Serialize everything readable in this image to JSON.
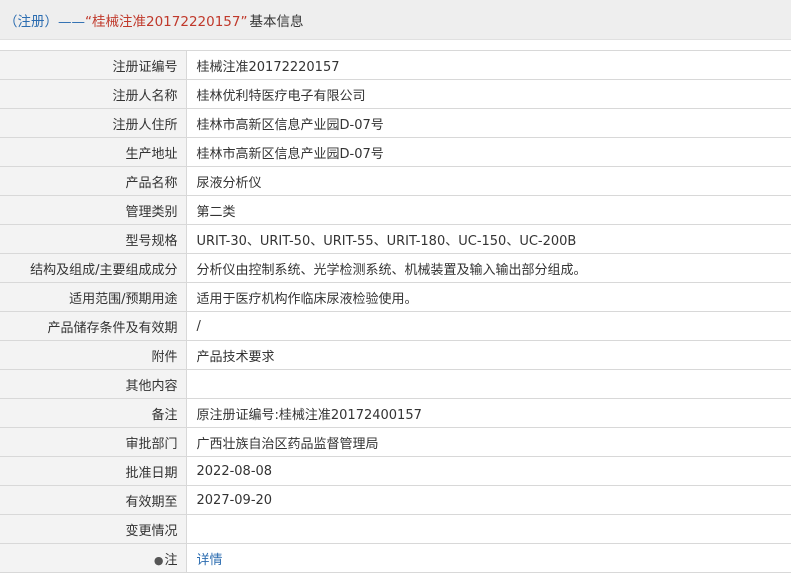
{
  "header": {
    "prefix": "（注册）——",
    "title": "“桂械注准20172220157”",
    "suffix": "基本信息"
  },
  "rows": [
    {
      "label": "注册证编号",
      "value": "桂械注准20172220157"
    },
    {
      "label": "注册人名称",
      "value": "桂林优利特医疗电子有限公司"
    },
    {
      "label": "注册人住所",
      "value": "桂林市高新区信息产业园D-07号"
    },
    {
      "label": "生产地址",
      "value": "桂林市高新区信息产业园D-07号"
    },
    {
      "label": "产品名称",
      "value": "尿液分析仪"
    },
    {
      "label": "管理类别",
      "value": "第二类"
    },
    {
      "label": "型号规格",
      "value": "URIT-30、URIT-50、URIT-55、URIT-180、UC-150、UC-200B"
    },
    {
      "label": "结构及组成/主要组成成分",
      "value": "分析仪由控制系统、光学检测系统、机械装置及输入输出部分组成。"
    },
    {
      "label": "适用范围/预期用途",
      "value": "适用于医疗机构作临床尿液检验使用。"
    },
    {
      "label": "产品储存条件及有效期",
      "value": "/"
    },
    {
      "label": "附件",
      "value": "产品技术要求"
    },
    {
      "label": "其他内容",
      "value": ""
    },
    {
      "label": "备注",
      "value": "原注册证编号:桂械注准20172400157"
    },
    {
      "label": "审批部门",
      "value": "广西壮族自治区药品监督管理局"
    },
    {
      "label": "批准日期",
      "value": "2022-08-08"
    },
    {
      "label": "有效期至",
      "value": "2027-09-20"
    },
    {
      "label": "变更情况",
      "value": ""
    }
  ],
  "note": {
    "icon": "lightbulb-icon",
    "label": "注",
    "link_text": "详情"
  }
}
